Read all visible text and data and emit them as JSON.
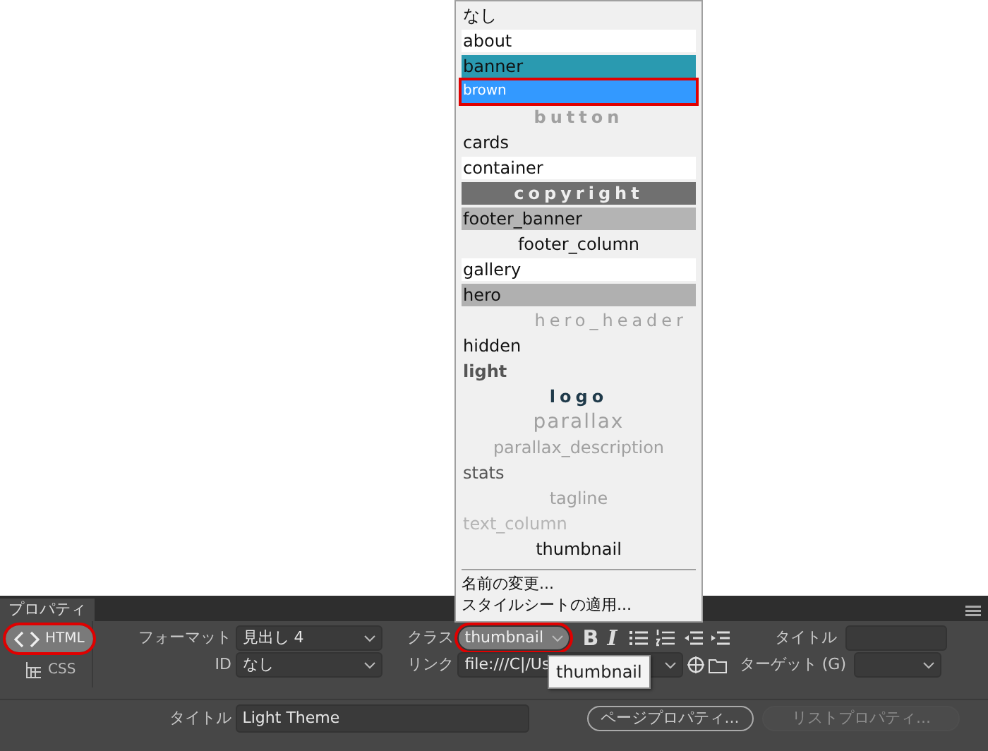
{
  "class_menu": {
    "items": [
      {
        "label": "なし",
        "kind": "plain",
        "color": "#111111",
        "selected": false
      },
      {
        "label": "about",
        "kind": "plain",
        "color": "#111111",
        "highlight": {
          "color": "#ffffff"
        },
        "selected": false
      },
      {
        "label": "banner",
        "kind": "plain",
        "color": "#111111",
        "highlight": {
          "color": "#2a9ab0"
        },
        "selected": false
      },
      {
        "label": "brown",
        "kind": "small",
        "color": "#ffffff",
        "highlight": {
          "color": "#3399ff"
        },
        "selected": true
      },
      {
        "label": "button",
        "kind": "spaced",
        "color": "#a0a0a0",
        "selected": false
      },
      {
        "label": "cards",
        "kind": "plain",
        "color": "#111111",
        "selected": false
      },
      {
        "label": "container",
        "kind": "plain",
        "color": "#111111",
        "highlight": {
          "color": "#ffffff"
        },
        "selected": false
      },
      {
        "label": "copyright",
        "kind": "spaced",
        "color": "#eeeeee",
        "highlight": {
          "color": "#707070"
        },
        "selected": false
      },
      {
        "label": "footer_banner",
        "kind": "plain",
        "color": "#111111",
        "highlight": {
          "color": "#b4b4b4"
        },
        "selected": false
      },
      {
        "label": "footer_column",
        "kind": "centered",
        "color": "#111111",
        "selected": false
      },
      {
        "label": "gallery",
        "kind": "plain",
        "color": "#111111",
        "highlight": {
          "color": "#ffffff"
        },
        "selected": false
      },
      {
        "label": "hero",
        "kind": "plain",
        "color": "#111111",
        "highlight": {
          "color": "#b0b0b0"
        },
        "selected": false
      },
      {
        "label": "hero_header",
        "kind": "wide",
        "color": "#a0a0a0",
        "selected": false
      },
      {
        "label": "hidden",
        "kind": "plain",
        "color": "#111111",
        "selected": false
      },
      {
        "label": "light",
        "kind": "bold",
        "color": "#555555",
        "selected": false
      },
      {
        "label": "logo",
        "kind": "spaced",
        "color": "#1f3a4a",
        "selected": false
      },
      {
        "label": "parallax",
        "kind": "large",
        "color": "#a0a0a0",
        "selected": false
      },
      {
        "label": "parallax_description",
        "kind": "centered",
        "color": "#a0a0a0",
        "selected": false
      },
      {
        "label": "stats",
        "kind": "plain",
        "color": "#555555",
        "selected": false
      },
      {
        "label": "tagline",
        "kind": "centered",
        "color": "#a0a0a0",
        "selected": false
      },
      {
        "label": "text_column",
        "kind": "plain",
        "color": "#b4b4b4",
        "selected": false
      },
      {
        "label": "thumbnail",
        "kind": "centered",
        "color": "#111111",
        "selected": false
      }
    ],
    "actions": [
      "名前の変更...",
      "スタイルシートの適用..."
    ]
  },
  "properties_panel": {
    "tab": "プロパティ",
    "modes": [
      {
        "label": "HTML",
        "selected": true,
        "highlighted": true
      },
      {
        "label": "CSS",
        "selected": false,
        "highlighted": false
      }
    ],
    "format": {
      "label": "フォーマット",
      "value": "見出し 4"
    },
    "id": {
      "label": "ID",
      "value": "なし"
    },
    "class": {
      "label": "クラス",
      "value": "thumbnail",
      "highlighted": true
    },
    "link": {
      "label": "リンク",
      "value": "file:///C|/Us"
    },
    "tooltip": "thumbnail",
    "text_buttons": [
      "B",
      "I"
    ],
    "link_title": {
      "label": "タイトル"
    },
    "target": {
      "label": "ターゲット (G)"
    },
    "page_title": {
      "label": "タイトル",
      "value": "Light Theme"
    },
    "buttons": [
      {
        "label": "ページプロパティ...",
        "disabled": false
      },
      {
        "label": "リストプロパティ...",
        "disabled": true
      }
    ]
  }
}
